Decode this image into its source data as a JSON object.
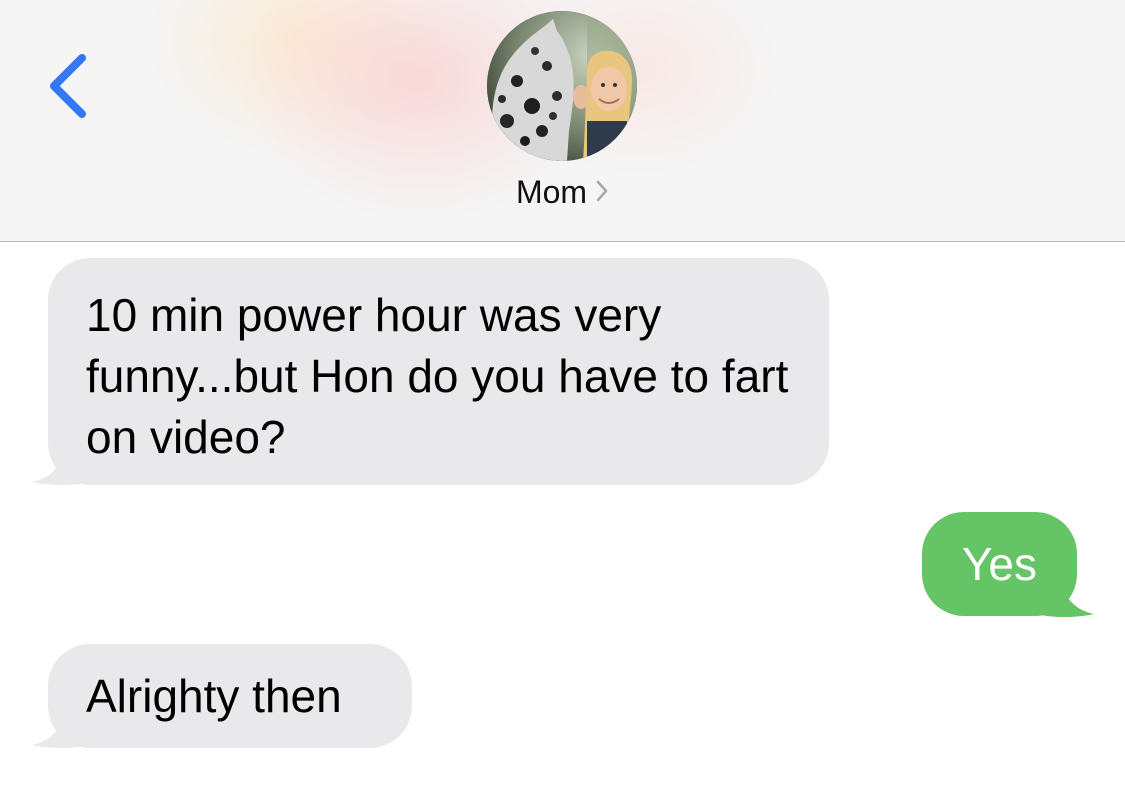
{
  "header": {
    "contact_name": "Mom",
    "back_icon": "chevron-left-icon",
    "name_chevron_icon": "chevron-right-icon",
    "accent_color": "#3478f6"
  },
  "messages": [
    {
      "direction": "incoming",
      "text": "10 min power hour was very funny...but Hon do you have to fart on video?"
    },
    {
      "direction": "outgoing",
      "text": "Yes"
    },
    {
      "direction": "incoming",
      "text": "Alrighty then"
    }
  ],
  "colors": {
    "incoming_bubble": "#e9e9eb",
    "outgoing_bubble": "#65c466"
  }
}
